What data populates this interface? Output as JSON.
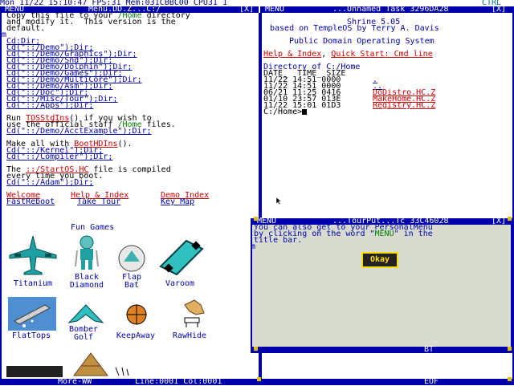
{
  "statusbar": {
    "text": "Mon 11/22 15:10:47 FPS:31 Mem:031CBBC00 CPU",
    "cpu_num": "31 1",
    "ctrl": "CTRL"
  },
  "left_window": {
    "title_menu": "MENU",
    "title": "Menu.DD.Z...C:/",
    "close": "[X]",
    "lines": [
      "Copy this file to your /Home directory",
      "and modify it.  This version is the",
      "default."
    ],
    "home_word": "/Home",
    "dirs": [
      "Cd:Dir;",
      "Cd(\"::/Demo\");Dir;",
      "Cd(\"::/Demo/Graphics\");Dir;",
      "Cd(\"::/Demo/Snd\");Dir;",
      "Cd(\"::/Demo/Dolphin\");Dir;",
      "Cd(\"::/Demo/Games\");Dir;",
      "Cd(\"::/Demo/MultiCore\");Dir;",
      "Cd(\"::/Demo/Asm\");Dir;",
      "Cd(\"::/Doc\");Dir;",
      "Cd(\"::/Misc/Tour\");Dir;",
      "Cd(\"::/Apps\");Dir;"
    ],
    "run_prefix": "Run ",
    "run_link": "TOSStdIns",
    "run_suffix": "() if you wish to",
    "use_line": "use the official staff ",
    "use_home": "/Home",
    "use_suffix": " files.",
    "acct_example": "Cd(\"::/Demo/AcctExample\");Dir;",
    "make_prefix": "Make all with ",
    "make_link": "BootHDIns",
    "make_suffix": "().",
    "kernel": "Cd(\"::/Kernel\");Dir;",
    "compiler": "Cd(\"::/Compiler\");Dir;",
    "the_prefix": "The ",
    "startos": "::/StartOS.HC",
    "the_suffix": " file is compiled",
    "every_time": "every time you boot.",
    "adam": "Cd(\"::/Adam\");Dir;",
    "welcome": "Welcome",
    "help_index": "Help & Index",
    "demo_index": "Demo Index",
    "fast_reboot": "FastReboot",
    "take_tour": "Take Tour",
    "key_map": "Key Map",
    "fun_games": "Fun Games",
    "games": [
      "Titanium",
      "Black Diamond",
      "Flap Bat",
      "Varoom",
      "FlatTops",
      "Bomber Golf",
      "KeepAway",
      "RawHide"
    ],
    "bottom_more": "More-WW",
    "bottom_line": "Line:0001 Col:0001"
  },
  "right_window": {
    "title_menu": "MENU",
    "title": "...Unnamed Task 3296DA28",
    "close": "[X]",
    "shrine": "Shrine 5.05",
    "based_on": "based on TempleOS by Terry A. Davis",
    "pd": "Public Domain Operating System",
    "help_link": "Help & Index",
    "comma": ", ",
    "quick_start": "Quick Start: Cmd line",
    "dir_header": "Directory of C:/Home",
    "col_header": "DATE_  TIME_ SIZE",
    "rows": [
      {
        "date": "11/22",
        "time": "14:51",
        "size": "0000",
        "name": "."
      },
      {
        "date": "11/22",
        "time": "14:51",
        "size": "0000",
        "name": ".."
      },
      {
        "date": "06/21",
        "time": "11:25",
        "size": "0416",
        "name": "DoDistro.HC.Z"
      },
      {
        "date": "01/10",
        "time": "23:57",
        "size": "013E",
        "name": "MakeHome.HC.Z"
      },
      {
        "date": "11/22",
        "time": "15:01",
        "size": "01D3",
        "name": "Registry.HC.Z"
      }
    ],
    "prompt": "C:/Home>"
  },
  "popup": {
    "title_menu": "MENU",
    "title": "...TourPut...Tc 33C46028",
    "close": "[X]",
    "line1_a": "You can also get to your PersonalMenu",
    "line2_a": "by clicking on the word \"",
    "line2_menu": "MENU",
    "line2_b": "\" in the",
    "line3": "title bar.",
    "cursor_m": "m",
    "ok": "Okay",
    "bt": "BT"
  },
  "right_bottom": {
    "eof": "EOF"
  },
  "colors": {
    "accent": "#0000aa",
    "link_red": "#cc0000",
    "popup_bg": "#d8dcd0",
    "corner": "#e0c000"
  }
}
